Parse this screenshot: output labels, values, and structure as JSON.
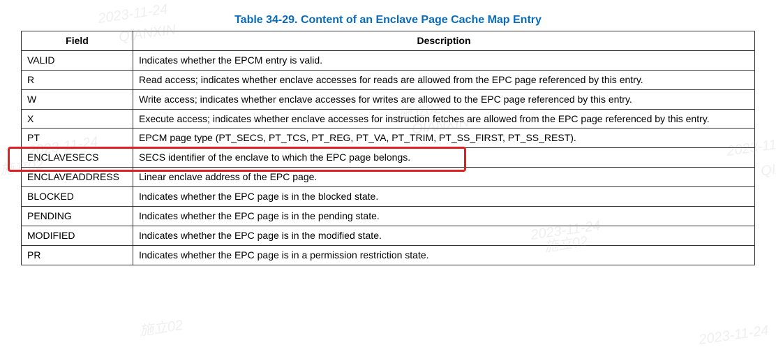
{
  "caption": "Table 34-29.  Content of an Enclave Page Cache Map Entry",
  "headers": {
    "field": "Field",
    "description": "Description"
  },
  "rows": [
    {
      "field": "VALID",
      "desc": "Indicates whether the EPCM entry is valid."
    },
    {
      "field": "R",
      "desc": "Read access; indicates whether enclave accesses for reads are allowed from the EPC page referenced by this entry."
    },
    {
      "field": "W",
      "desc": "Write access; indicates whether enclave accesses for writes are allowed to the EPC page referenced by this entry."
    },
    {
      "field": "X",
      "desc": "Execute access; indicates whether enclave accesses for instruction fetches are allowed from the EPC page referenced by this entry."
    },
    {
      "field": "PT",
      "desc": "EPCM page type (PT_SECS, PT_TCS, PT_REG, PT_VA, PT_TRIM, PT_SS_FIRST, PT_SS_REST)."
    },
    {
      "field": "ENCLAVESECS",
      "desc": "SECS identifier of the enclave to which the EPC page belongs."
    },
    {
      "field": "ENCLAVEADDRESS",
      "desc": "Linear enclave address of the EPC page."
    },
    {
      "field": "BLOCKED",
      "desc": "Indicates whether the EPC page is in the blocked state."
    },
    {
      "field": "PENDING",
      "desc": "Indicates whether the EPC page is in the pending state."
    },
    {
      "field": "MODIFIED",
      "desc": "Indicates whether the EPC page is in the modified state."
    },
    {
      "field": "PR",
      "desc": "Indicates whether the EPC page is in a permission restriction state."
    }
  ],
  "watermark": {
    "date": "2023-11-24",
    "text1": "施立02",
    "text2": "QIANXIN"
  }
}
